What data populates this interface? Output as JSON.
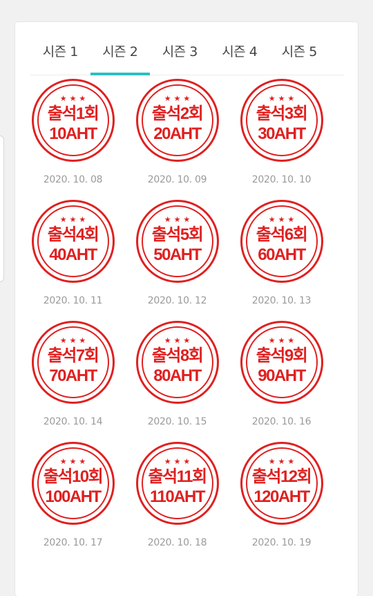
{
  "tabs": [
    {
      "label": "시즌 1",
      "active": false
    },
    {
      "label": "시즌 2",
      "active": true
    },
    {
      "label": "시즌 3",
      "active": false
    },
    {
      "label": "시즌 4",
      "active": false
    },
    {
      "label": "시즌 5",
      "active": false
    }
  ],
  "stamp_stars": "★★★",
  "stamps": [
    {
      "count": "출석1회",
      "reward": "10AHT",
      "date": "2020. 10. 08"
    },
    {
      "count": "출석2회",
      "reward": "20AHT",
      "date": "2020. 10. 09"
    },
    {
      "count": "출석3회",
      "reward": "30AHT",
      "date": "2020. 10. 10"
    },
    {
      "count": "출석4회",
      "reward": "40AHT",
      "date": "2020. 10. 11"
    },
    {
      "count": "출석5회",
      "reward": "50AHT",
      "date": "2020. 10. 12"
    },
    {
      "count": "출석6회",
      "reward": "60AHT",
      "date": "2020. 10. 13"
    },
    {
      "count": "출석7회",
      "reward": "70AHT",
      "date": "2020. 10. 14"
    },
    {
      "count": "출석8회",
      "reward": "80AHT",
      "date": "2020. 10. 15"
    },
    {
      "count": "출석9회",
      "reward": "90AHT",
      "date": "2020. 10. 16"
    },
    {
      "count": "출석10회",
      "reward": "100AHT",
      "date": "2020. 10. 17"
    },
    {
      "count": "출석11회",
      "reward": "110AHT",
      "date": "2020. 10. 18"
    },
    {
      "count": "출석12회",
      "reward": "120AHT",
      "date": "2020. 10. 19"
    }
  ],
  "colors": {
    "stamp": "#e02020",
    "accent": "#2bc0c2",
    "date": "#9a9a9a"
  }
}
